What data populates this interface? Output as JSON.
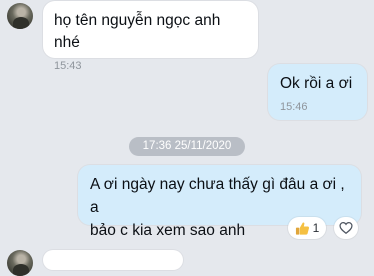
{
  "messages": [
    {
      "text": "họ tên nguyễn ngọc anh nhé",
      "time": "15:43"
    },
    {
      "text": "Ok rồi a ơi",
      "time": "15:46"
    },
    {
      "text": "A ơi ngày nay chưa thấy gì đâu a ơi , a\nbảo c kia xem sao anh"
    }
  ],
  "date_separator": "17:36 25/11/2020",
  "reaction": {
    "icon": "thumbs-up-icon",
    "count": "1"
  },
  "colors": {
    "background": "#e5e8ed",
    "incoming": "#ffffff",
    "outgoing": "#d4ecfb"
  }
}
